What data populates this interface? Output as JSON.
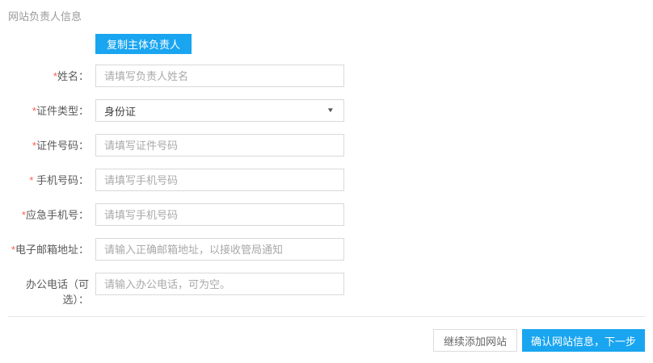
{
  "page": {
    "title": "网站负责人信息"
  },
  "colors": {
    "accent": "#19A5F0",
    "label": "#595959",
    "asterisk": "#ff5c4c",
    "border": "#d9d9d9",
    "placeholder": "#a9a9a9",
    "title": "#9a9a9a",
    "divider": "#e5e5e5"
  },
  "form": {
    "copy_button": "复制主体负责人",
    "fields": [
      {
        "required": "*",
        "label": "姓名：",
        "type": "input",
        "placeholder": "请填写负责人姓名",
        "value": ""
      },
      {
        "required": "*",
        "label": "证件类型：",
        "type": "select",
        "value": "身份证",
        "icon": "chevron-down"
      },
      {
        "required": "*",
        "label": "证件号码：",
        "type": "input",
        "placeholder": "请填写证件号码",
        "value": ""
      },
      {
        "required": "* ",
        "label": "手机号码：",
        "type": "input",
        "placeholder": "请填写手机号码",
        "value": ""
      },
      {
        "required": "*",
        "label": "应急手机号：",
        "type": "input",
        "placeholder": "请填写手机号码",
        "value": ""
      },
      {
        "required": "*",
        "label": "电子邮箱地址：",
        "type": "input",
        "placeholder": "请输入正确邮箱地址，以接收管局通知",
        "value": ""
      },
      {
        "required": "",
        "label": "办公电话（可选）：",
        "type": "input",
        "placeholder": "请输入办公电话，可为空。",
        "value": ""
      }
    ]
  },
  "footer": {
    "continue_button": "继续添加网站",
    "confirm_button": "确认网站信息，下一步"
  }
}
